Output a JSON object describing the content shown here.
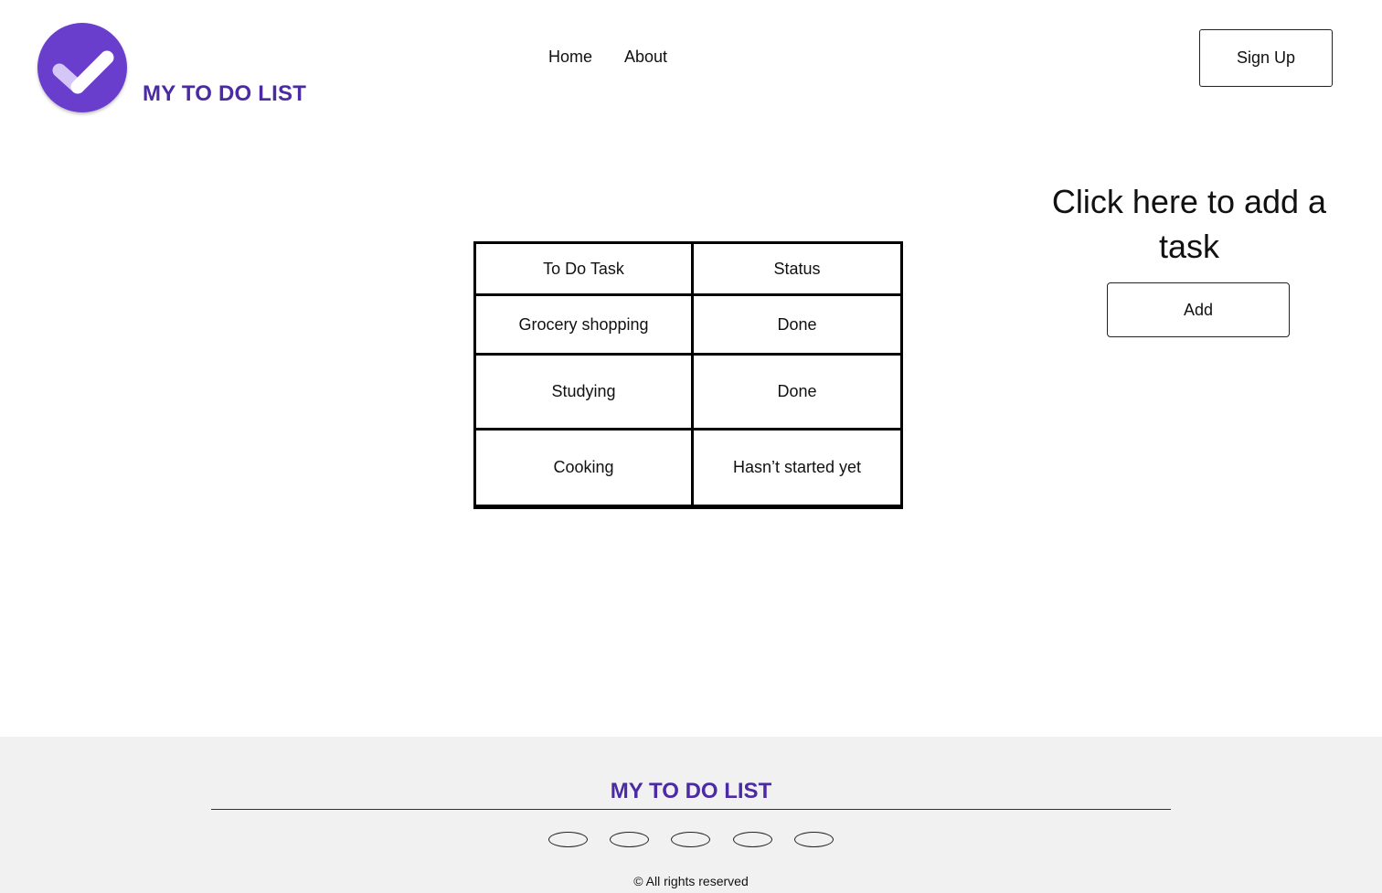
{
  "header": {
    "logo_icon": "checkmark-circle-icon",
    "brand": "MY TO DO LIST",
    "nav": [
      {
        "label": "Home"
      },
      {
        "label": "About"
      }
    ],
    "signup_label": "Sign Up"
  },
  "main": {
    "table": {
      "columns": [
        "To Do Task",
        "Status"
      ],
      "rows": [
        {
          "task": "Grocery shopping",
          "status": "Done"
        },
        {
          "task": "Studying",
          "status": "Done"
        },
        {
          "task": "Cooking",
          "status": "Hasn’t started yet"
        }
      ]
    },
    "add_heading": "Click here to add a task",
    "add_label": "Add"
  },
  "footer": {
    "brand": "MY TO DO LIST",
    "social_icons": [
      "social-icon-1",
      "social-icon-2",
      "social-icon-3",
      "social-icon-4",
      "social-icon-5"
    ],
    "copyright": "© All rights reserved"
  },
  "colors": {
    "brand_purple": "#4b2aa3",
    "logo_purple": "#6a3ecc",
    "footer_bg": "#f1f1f1"
  }
}
